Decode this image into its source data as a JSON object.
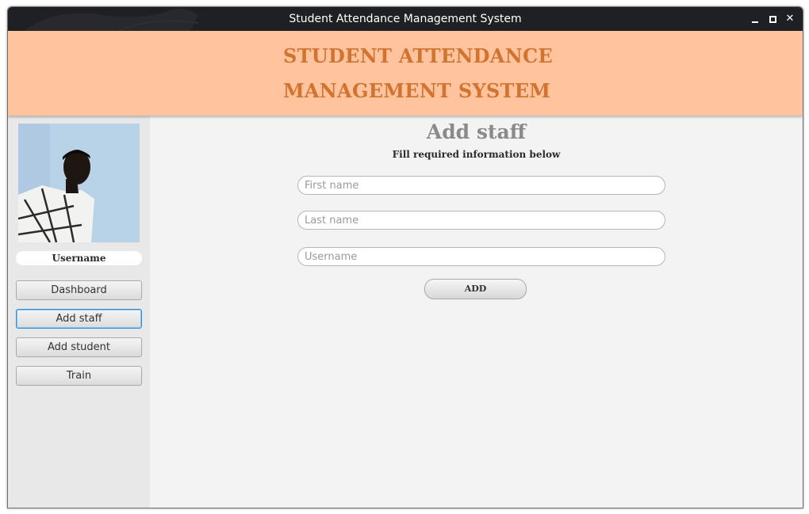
{
  "window": {
    "title": "Student Attendance Management System",
    "controls": {
      "minimize_icon": "minimize-icon",
      "maximize_icon": "maximize-icon",
      "close_icon": "close-icon",
      "close_glyph": "✕"
    }
  },
  "header": {
    "line1": "STUDENT ATTENDANCE",
    "line2": "MANAGEMENT SYSTEM",
    "background": "#ffc39e",
    "text_color": "#d2732f"
  },
  "sidebar": {
    "avatar": "profile-photo",
    "username": "Username",
    "items": [
      {
        "label": "Dashboard",
        "active": false
      },
      {
        "label": "Add staff",
        "active": true
      },
      {
        "label": "Add student",
        "active": false
      },
      {
        "label": "Train",
        "active": false
      }
    ]
  },
  "main": {
    "title": "Add staff",
    "subtitle": "Fill required information below",
    "fields": {
      "first_name": {
        "placeholder": "First name",
        "value": ""
      },
      "last_name": {
        "placeholder": "Last name",
        "value": ""
      },
      "username": {
        "placeholder": "Username",
        "value": ""
      }
    },
    "add_label": "ADD"
  }
}
